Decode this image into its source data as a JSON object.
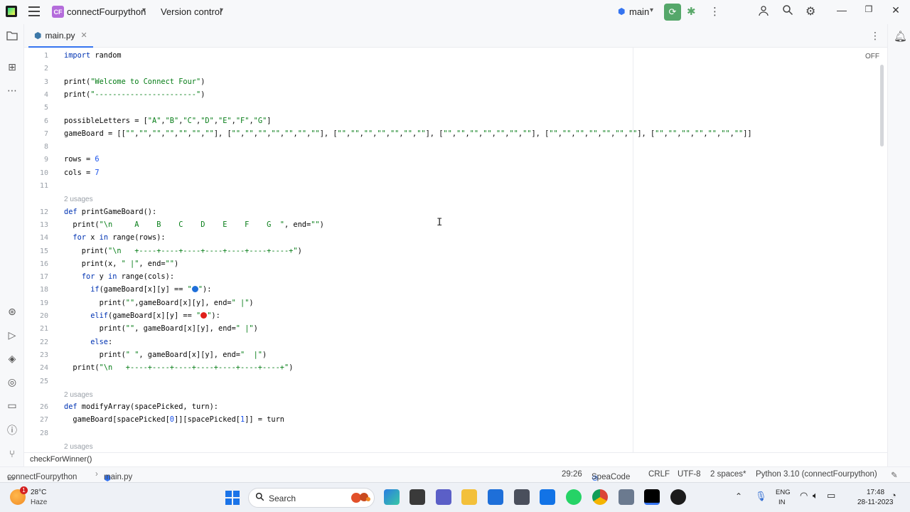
{
  "titlebar": {
    "project_badge": "CF",
    "project_name": "connectFourpython",
    "version_control": "Version control",
    "branch": "main"
  },
  "editor": {
    "tab": "main.py",
    "inspection_toggle": "OFF"
  },
  "code": {
    "line_numbers": [
      "1",
      "2",
      "3",
      "4",
      "5",
      "6",
      "7",
      "8",
      "9",
      "10",
      "11",
      "12",
      "13",
      "14",
      "15",
      "16",
      "17",
      "18",
      "19",
      "20",
      "21",
      "22",
      "23",
      "24",
      "25",
      "26",
      "27",
      "28"
    ],
    "usage_hint": "2 usages",
    "lines": [
      "import random",
      "",
      "print(\"Welcome to Connect Four\")",
      "print(\"-----------------------\")",
      "",
      "possibleLetters = [\"A\",\"B\",\"C\",\"D\",\"E\",\"F\",\"G\"]",
      "gameBoard = [[\"\",\"\",\"\",\"\",\"\",\"\",\"\"], [\"\",\"\",\"\",\"\",\"\",\"\",\"\"], [\"\",\"\",\"\",\"\",\"\",\"\",\"\"], [\"\",\"\",\"\",\"\",\"\",\"\",\"\"], [\"\",\"\",\"\",\"\",\"\",\"\",\"\"], [\"\",\"\",\"\",\"\",\"\",\"\",\"\"]]",
      "",
      "rows = 6",
      "cols = 7",
      "",
      "def printGameBoard():",
      "  print(\"\\n     A    B    C    D    E    F    G  \", end=\"\")",
      "  for x in range(rows):",
      "    print(\"\\n   +----+----+----+----+----+----+----+\")",
      "    print(x, \" |\", end=\"\")",
      "    for y in range(cols):",
      "      if(gameBoard[x][y] == \"\"):",
      "        print(\"\",gameBoard[x][y], end=\" |\")",
      "      elif(gameBoard[x][y] == \"\"):",
      "        print(\"\", gameBoard[x][y], end=\" |\")",
      "      else:",
      "        print(\" \", gameBoard[x][y], end=\"  |\")",
      "  print(\"\\n   +----+----+----+----+----+----+----+\")",
      "",
      "def modifyArray(spacePicked, turn):",
      "  gameBoard[spacePicked[0]][spacePicked[1]] = turn",
      ""
    ]
  },
  "breadcrumb": {
    "function": "checkForWinner()"
  },
  "statusbar": {
    "project": "connectFourpython",
    "file": "main.py",
    "position": "29:26",
    "plugin": "SpeaCode",
    "line_ending": "CRLF",
    "encoding": "UTF-8",
    "indent": "2 spaces*",
    "interpreter": "Python 3.10 (connectFourpython)"
  },
  "taskbar": {
    "weather_temp": "28°C",
    "weather_desc": "Haze",
    "weather_badge": "1",
    "search_label": "Search",
    "lang_top": "ENG",
    "lang_bottom": "IN",
    "time": "17:48",
    "date": "28-11-2023"
  },
  "colors": {
    "accent": "#3574f0",
    "run_green": "#55a76a",
    "keyword": "#0033b3",
    "string": "#067d17",
    "number": "#1750eb",
    "blue_circle": "#1e6fd9",
    "red_circle": "#e0201b"
  }
}
